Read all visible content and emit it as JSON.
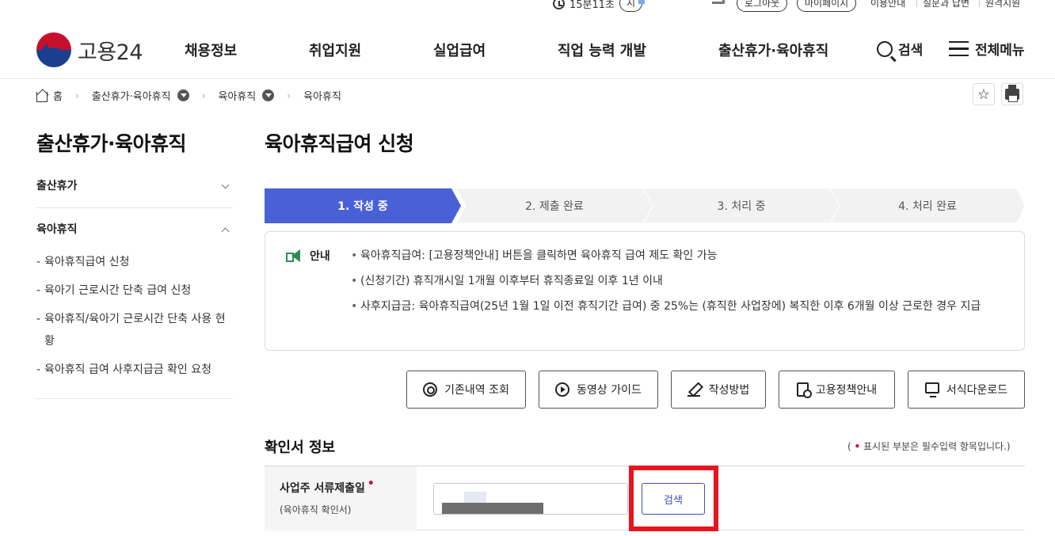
{
  "utility": {
    "timer": "15분11초",
    "extend_label": "시",
    "logout": "로그아웃",
    "mypage": "마이페이지",
    "guide": "이용안내",
    "qa": "질문과 답변",
    "remote": "원격지원"
  },
  "header": {
    "logo_text": "고용24",
    "nav": [
      "채용정보",
      "취업지원",
      "실업급여",
      "직업 능력 개발",
      "출산휴가·육아휴직"
    ],
    "search_label": "검색",
    "menu_label": "전체메뉴"
  },
  "breadcrumb": {
    "home": "홈",
    "items": [
      "출산휴가·육아휴직",
      "육아휴직",
      "육아휴직"
    ]
  },
  "sidebar": {
    "title": "출산휴가·육아휴직",
    "groups": [
      {
        "label": "출산휴가",
        "expanded": false
      },
      {
        "label": "육아휴직",
        "expanded": true,
        "items": [
          "육아휴직급여 신청",
          "육아기 근로시간 단축 급여 신청",
          "육아휴직/육아기 근로시간 단축 사용 현황",
          "육아휴직 급여 사후지급금 확인 요청"
        ]
      }
    ]
  },
  "main": {
    "title": "육아휴직급여 신청",
    "steps": [
      {
        "label": "1. 작성 중",
        "active": true
      },
      {
        "label": "2. 제출 완료",
        "active": false
      },
      {
        "label": "3. 처리 중",
        "active": false
      },
      {
        "label": "4. 처리 완료",
        "active": false
      }
    ],
    "notice": {
      "heading": "안내",
      "items": [
        "육아휴직급여: [고용정책안내] 버튼을 클릭하면 육아휴직 급여 제도 확인 가능",
        "(신청기간) 휴직개시일 1개월 이후부터 휴직종료일 이후 1년 이내",
        "사후지급금: 육아휴직급여(25년 1월 1일 이전 휴직기간 급여) 중 25%는 (휴직한 사업장에) 복직한 이후 6개월 이상 근로한 경우 지급"
      ]
    },
    "actions": [
      {
        "label": "기존내역 조회",
        "icon": "at-icon"
      },
      {
        "label": "동영상 가이드",
        "icon": "play-icon"
      },
      {
        "label": "작성방법",
        "icon": "pen-icon"
      },
      {
        "label": "고용정책안내",
        "icon": "document-search-icon"
      },
      {
        "label": "서식다운로드",
        "icon": "monitor-icon"
      }
    ],
    "section_title": "확인서 정보",
    "required_note_pre": "(",
    "required_note_dot": "•",
    "required_note_post": "표시된 부분은 필수입력 항목입니다.)",
    "form": {
      "label": "사업주 서류제출일",
      "required_mark": "•",
      "sublabel": "(육아휴직 확인서)",
      "search_button": "검색"
    }
  },
  "colors": {
    "active_step": "#4a61d6",
    "inactive_step": "#f2f2f2",
    "accent_blue": "#3b4fbd",
    "required_red": "#d0103a",
    "highlight_red": "#e8141e",
    "notice_icon": "#2e8b57"
  }
}
